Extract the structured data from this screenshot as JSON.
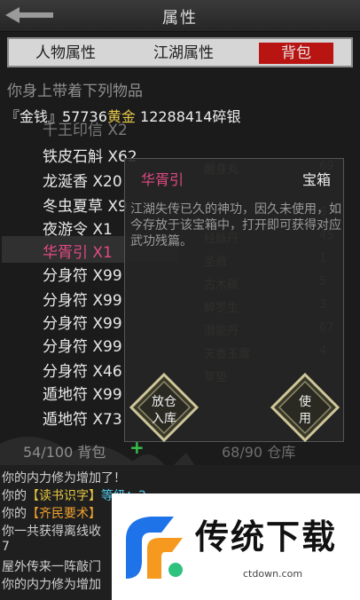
{
  "header": {
    "title": "属性"
  },
  "tabs": {
    "character": "人物属性",
    "jianghu": "江湖属性",
    "bag": "背包"
  },
  "carry_title": "你身上带着下列物品",
  "money": {
    "prefix": "『金钱』57736",
    "gold": "黄金",
    "rest": " 12288414碎银"
  },
  "items": [
    {
      "label": "千王印信 X2",
      "state": "dim"
    },
    {
      "label": "铁皮石斛 X62",
      "state": "normal"
    },
    {
      "label": "龙涎香 X20",
      "state": "normal"
    },
    {
      "label": "冬虫夏草 X9",
      "state": "normal"
    },
    {
      "label": "夜游令 X1",
      "state": "normal"
    },
    {
      "label": "华胥引 X1",
      "state": "selected"
    },
    {
      "label": "分身符 X99",
      "state": "normal"
    },
    {
      "label": "分身符 X99",
      "state": "normal"
    },
    {
      "label": "分身符 X99",
      "state": "normal"
    },
    {
      "label": "分身符 X99",
      "state": "normal"
    },
    {
      "label": "分身符 X46",
      "state": "normal"
    },
    {
      "label": "遁地符 X99",
      "state": "normal"
    },
    {
      "label": "遁地符 X73",
      "state": "normal"
    }
  ],
  "right_items": [
    {
      "label": "醒身丸",
      "count": "69"
    },
    {
      "label": "",
      "count": ""
    },
    {
      "label": "",
      "count": "6"
    },
    {
      "label": "经脉丹",
      "count": "45"
    },
    {
      "label": "圣救",
      "count": "1"
    },
    {
      "label": "古木碳",
      "count": "5"
    },
    {
      "label": "醉罗生",
      "count": "3"
    },
    {
      "label": "潜能丹",
      "count": "67"
    },
    {
      "label": "天香玉露",
      "count": "4"
    },
    {
      "label": "草垫",
      "count": ""
    }
  ],
  "popup": {
    "name": "华胥引",
    "type": "宝箱",
    "description": "江湖失传已久的神功，因久未使用，如今存放于该宝箱中，打开即可获得对应武功残篇。",
    "store_button": {
      "line1": "放仓",
      "line2": "入库"
    },
    "use_button": {
      "line1": "使",
      "line2": "用"
    }
  },
  "bag": {
    "count": "54/100 背包",
    "plus": "+",
    "warehouse": "68/90 仓库"
  },
  "log": {
    "line1": "你的内力修为增加了！",
    "line2_prefix": "你的",
    "line2_item": "【读书识字】",
    "line2_suffix": "等级：2",
    "line3_prefix": "你的",
    "line3_item": "【齐民要术】",
    "line4": "你一共获得离线收",
    "line5": "7",
    "line6": "屋外传来一阵敲门",
    "line7": "你的内力修为增加"
  },
  "ad": {
    "title": "传统下载",
    "url": "ctdown.com"
  },
  "colors": {
    "accent_red": "#b81412",
    "selected_pink": "#e24a84",
    "gold": "#e6c84a",
    "green": "#34c34a"
  }
}
